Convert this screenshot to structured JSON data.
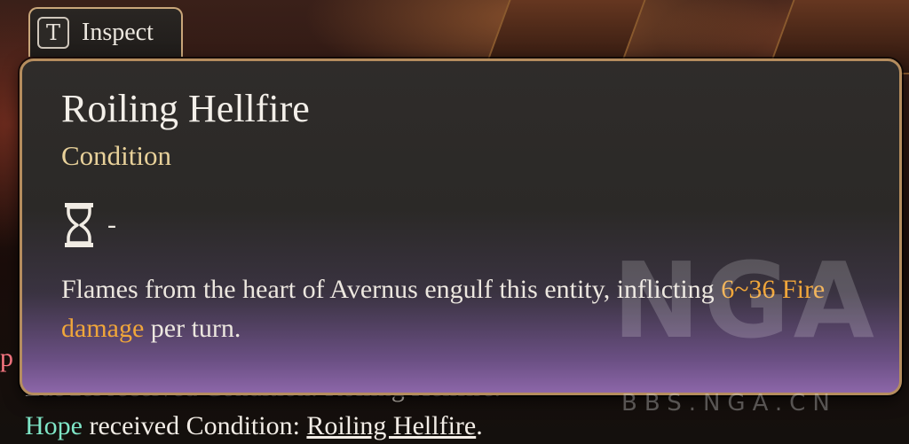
{
  "inspect_tab": {
    "key": "T",
    "label": "Inspect"
  },
  "tooltip": {
    "title": "Roiling Hellfire",
    "subtitle": "Condition",
    "duration_icon": "hourglass-icon",
    "duration_value": "-",
    "description_part1": "Flames from the heart of Avernus engulf this entity, inflicting ",
    "description_damage": "6~36 Fire damage",
    "description_part2": " per turn."
  },
  "combat_log": {
    "partial_line": "Lae'zel received Condition: Roiling Hellfire.",
    "left_fragment": "p",
    "line_name": "Hope",
    "line_text": " received Condition: ",
    "line_condition": "Roiling Hellfire",
    "line_end": "."
  },
  "watermark": {
    "logo": "NGA",
    "url": "BBS.NGA.CN"
  },
  "colors": {
    "tooltip_border": "#b58d5e",
    "subtitle": "#e8d19a",
    "damage_highlight": "#f0a63a",
    "name_highlight": "#7fe6c7"
  }
}
